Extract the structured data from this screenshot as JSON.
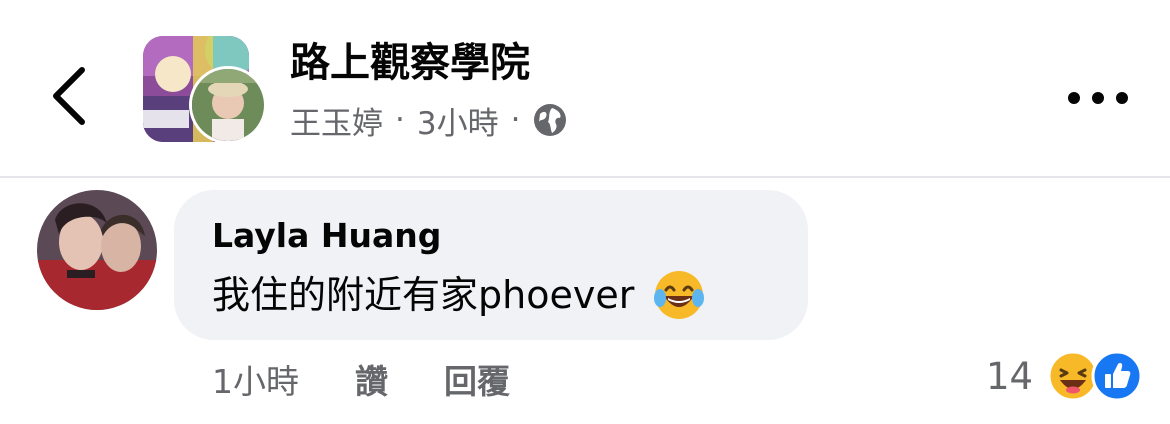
{
  "header": {
    "group_name": "路上觀察學院",
    "poster_name": "王玉婷",
    "separator": "·",
    "time": "3小時",
    "audience_icon": "globe-icon",
    "back_icon": "chevron-left-icon",
    "more_icon": "more-horizontal-icon"
  },
  "comment": {
    "author": "Layla Huang",
    "text": "我住的附近有家phoever",
    "emoji": "laughing-tears-emoji",
    "time": "1小時",
    "like_label": "讚",
    "reply_label": "回覆",
    "reaction_count": "14",
    "reaction_icons": [
      "haha-reaction-icon",
      "like-reaction-icon"
    ]
  },
  "colors": {
    "bubble_bg": "#f0f2f5",
    "secondary_text": "#65676b",
    "primary_text": "#050505",
    "like_blue": "#1877f2",
    "haha_yellow": "#f7b928"
  }
}
